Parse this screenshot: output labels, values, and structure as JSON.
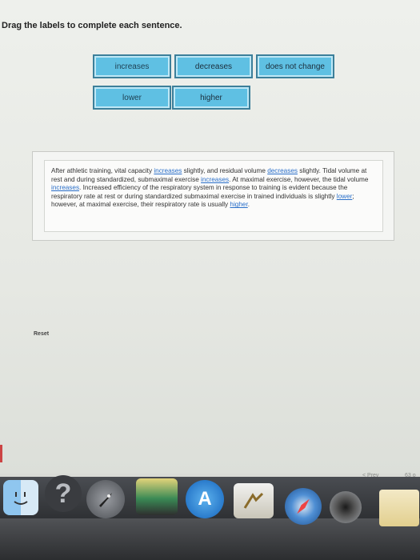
{
  "instruction": "Drag the labels to complete each sentence.",
  "labels": {
    "increases": "increases",
    "decreases": "decreases",
    "does_not_change": "does not change",
    "lower": "lower",
    "higher": "higher"
  },
  "sentence": {
    "p1": "After athletic training, vital capacity ",
    "b1": "increases",
    "p2": " slightly, and residual volume ",
    "b2": "decreases",
    "p3": " slightly. Tidal volume at rest and during standardized, submaximal exercise ",
    "b3": "increases",
    "p4": ". At maximal exercise, however, the tidal volume ",
    "b4": "increases",
    "p5": ". Increased efficiency of the respiratory system in response to training is evident because the respiratory rate at rest or during standardized submaximal exercise in trained individuals is slightly ",
    "b5": "lower",
    "p6": "; however, at maximal exercise, their respiratory rate is usually ",
    "b6": "higher",
    "p7": "."
  },
  "reset_label": "Reset",
  "prev_label": "< Prev",
  "page_indicator": "63 o",
  "colors": {
    "label_fill": "#5fc0e3",
    "blank_text": "#2a6fc9"
  },
  "dock_icons": [
    "finder-icon",
    "help-icon",
    "launchpad-icon",
    "app-icon",
    "app-store-icon",
    "preview-icon",
    "safari-icon",
    "camera-icon",
    "notes-icon"
  ]
}
